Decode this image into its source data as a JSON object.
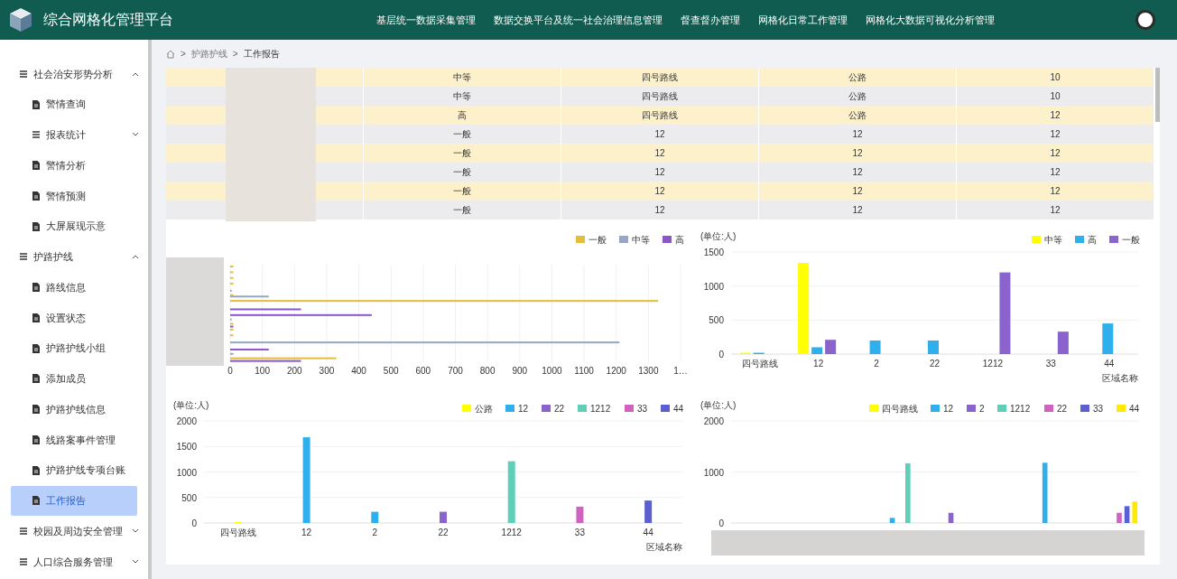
{
  "header": {
    "title": "综合网格化管理平台",
    "nav": [
      "基层统一数据采集管理",
      "数据交换平台及统一社会治理信息管理",
      "督查督办管理",
      "网格化日常工作管理",
      "网格化大数据可视化分析管理"
    ]
  },
  "sidebar": {
    "items": [
      {
        "label": "社会治安形势分析",
        "kind": "group",
        "expanded": true,
        "selected": false,
        "children": [
          {
            "label": "警情查询",
            "kind": "page",
            "selected": false
          },
          {
            "label": "报表统计",
            "kind": "group",
            "expanded": false,
            "selected": false
          },
          {
            "label": "警情分析",
            "kind": "page",
            "selected": false
          },
          {
            "label": "警情预测",
            "kind": "page",
            "selected": false
          },
          {
            "label": "大屏展现示意",
            "kind": "page",
            "selected": false
          }
        ]
      },
      {
        "label": "护路护线",
        "kind": "group",
        "expanded": true,
        "selected": false,
        "children": [
          {
            "label": "路线信息",
            "kind": "page",
            "selected": false
          },
          {
            "label": "设置状态",
            "kind": "page",
            "selected": false
          },
          {
            "label": "护路护线小组",
            "kind": "page",
            "selected": false
          },
          {
            "label": "添加成员",
            "kind": "page",
            "selected": false
          },
          {
            "label": "护路护线信息",
            "kind": "page",
            "selected": false
          },
          {
            "label": "线路案事件管理",
            "kind": "page",
            "selected": false
          },
          {
            "label": "护路护线专项台账",
            "kind": "page",
            "selected": false
          },
          {
            "label": "工作报告",
            "kind": "page",
            "selected": true
          }
        ]
      },
      {
        "label": "校园及周边安全管理",
        "kind": "group",
        "expanded": false,
        "selected": false
      },
      {
        "label": "人口综合服务管理",
        "kind": "group",
        "expanded": false,
        "selected": false
      }
    ]
  },
  "breadcrumb": {
    "separator": ">",
    "items": [
      "护路护线",
      "工作报告"
    ]
  },
  "table": {
    "rows": [
      {
        "cells": [
          "中等",
          "四号路线",
          "公路",
          "10"
        ]
      },
      {
        "cells": [
          "中等",
          "四号路线",
          "公路",
          "10"
        ]
      },
      {
        "cells": [
          "高",
          "四号路线",
          "公路",
          "12"
        ]
      },
      {
        "cells": [
          "一般",
          "12",
          "12",
          "12"
        ]
      },
      {
        "cells": [
          "一般",
          "12",
          "12",
          "12"
        ]
      },
      {
        "cells": [
          "一般",
          "12",
          "12",
          "12"
        ]
      },
      {
        "cells": [
          "一般",
          "12",
          "12",
          "12"
        ]
      },
      {
        "cells": [
          "一般",
          "12",
          "12",
          "12"
        ]
      }
    ]
  },
  "charts": [
    {
      "chart_data": {
        "type": "bar",
        "orientation": "horizontal",
        "grid": true,
        "legend": "top-right",
        "xlim": [
          0,
          1400
        ],
        "xticks": [
          0,
          100,
          200,
          300,
          400,
          500,
          600,
          700,
          800,
          900,
          1000,
          1100,
          1200,
          1300,
          {
            "value": 1400,
            "label": "1…"
          }
        ],
        "series": [
          {
            "name": "一般",
            "color": "#e3bd3c",
            "values": [
              10,
              10,
              10,
              10,
              null,
              10,
              1330,
              null,
              null,
              null,
              10,
              10,
              10,
              null,
              null,
              null,
              330
            ]
          },
          {
            "name": "中等",
            "color": "#97a6c4",
            "values": [
              null,
              null,
              null,
              null,
              5,
              120,
              null,
              null,
              null,
              5,
              null,
              null,
              null,
              1210,
              null,
              10,
              null
            ]
          },
          {
            "name": "高",
            "color": "#8a56c9",
            "values": [
              null,
              null,
              null,
              null,
              null,
              null,
              null,
              220,
              440,
              null,
              10,
              null,
              null,
              null,
              120,
              null,
              220
            ]
          }
        ]
      }
    },
    {
      "chart_data": {
        "type": "bar",
        "grid": true,
        "legend": "top-right",
        "ylabel": "(单位:人)",
        "xlabel": "区域名称",
        "categories": [
          "四号路线",
          "12",
          "2",
          "22",
          "1212",
          "33",
          "44"
        ],
        "ylim": [
          0,
          1500
        ],
        "yticks": [
          0,
          500,
          1000,
          1500
        ],
        "series": [
          {
            "name": "中等",
            "color": "#ffff00",
            "values": [
              20,
              1340,
              null,
              null,
              null,
              null,
              null
            ]
          },
          {
            "name": "高",
            "color": "#2fb0ec",
            "values": [
              20,
              100,
              200,
              200,
              null,
              null,
              450
            ]
          },
          {
            "name": "一般",
            "color": "#8b63cc",
            "values": [
              null,
              210,
              null,
              null,
              1200,
              330,
              null
            ]
          }
        ]
      }
    },
    {
      "chart_data": {
        "type": "bar",
        "grid": true,
        "legend": "top-right",
        "stacked": true,
        "ylabel": "(单位:人)",
        "xlabel": "区域名称",
        "categories": [
          "四号路线",
          "12",
          "2",
          "22",
          "1212",
          "33",
          "44"
        ],
        "ylim": [
          0,
          2000
        ],
        "yticks": [
          0,
          500,
          1000,
          1500,
          2000
        ],
        "series": [
          {
            "name": "公路",
            "color": "#ffff00",
            "values": [
              20,
              null,
              null,
              null,
              null,
              null,
              null
            ]
          },
          {
            "name": "12",
            "color": "#2fb0ec",
            "values": [
              null,
              1680,
              220,
              null,
              null,
              null,
              null
            ]
          },
          {
            "name": "22",
            "color": "#8b63cc",
            "values": [
              null,
              null,
              null,
              220,
              null,
              null,
              null
            ]
          },
          {
            "name": "1212",
            "color": "#5fcfb8",
            "values": [
              null,
              null,
              null,
              null,
              1210,
              null,
              null
            ]
          },
          {
            "name": "33",
            "color": "#d163c0",
            "values": [
              null,
              null,
              null,
              null,
              null,
              320,
              null
            ]
          },
          {
            "name": "44",
            "color": "#5b5fcf",
            "values": [
              null,
              null,
              null,
              null,
              null,
              null,
              440
            ]
          }
        ]
      }
    },
    {
      "chart_data": {
        "type": "bar",
        "grid": true,
        "legend": "top-right",
        "ylabel": "(单位:人)",
        "ylim": [
          0,
          2000
        ],
        "yticks": [
          0,
          1000,
          2000
        ],
        "series": [
          {
            "name": "四号路线",
            "color": "#ffff00",
            "values": [
              null,
              null,
              null,
              null,
              null,
              null,
              null,
              null
            ]
          },
          {
            "name": "12",
            "color": "#2fb0ec",
            "values": [
              null,
              null,
              null,
              100,
              null,
              null,
              1180,
              null
            ]
          },
          {
            "name": "2",
            "color": "#8b63cc",
            "values": [
              null,
              null,
              null,
              null,
              200,
              null,
              null,
              null
            ]
          },
          {
            "name": "1212",
            "color": "#5fcfb8",
            "values": [
              null,
              null,
              null,
              1170,
              null,
              null,
              null,
              null
            ]
          },
          {
            "name": "22",
            "color": "#d163c0",
            "values": [
              null,
              null,
              null,
              null,
              null,
              null,
              null,
              200
            ]
          },
          {
            "name": "33",
            "color": "#5b5fcf",
            "values": [
              null,
              null,
              null,
              null,
              null,
              null,
              null,
              330
            ]
          },
          {
            "name": "44",
            "color": "#ffea00",
            "values": [
              null,
              null,
              null,
              null,
              null,
              null,
              null,
              420
            ]
          }
        ]
      }
    }
  ]
}
